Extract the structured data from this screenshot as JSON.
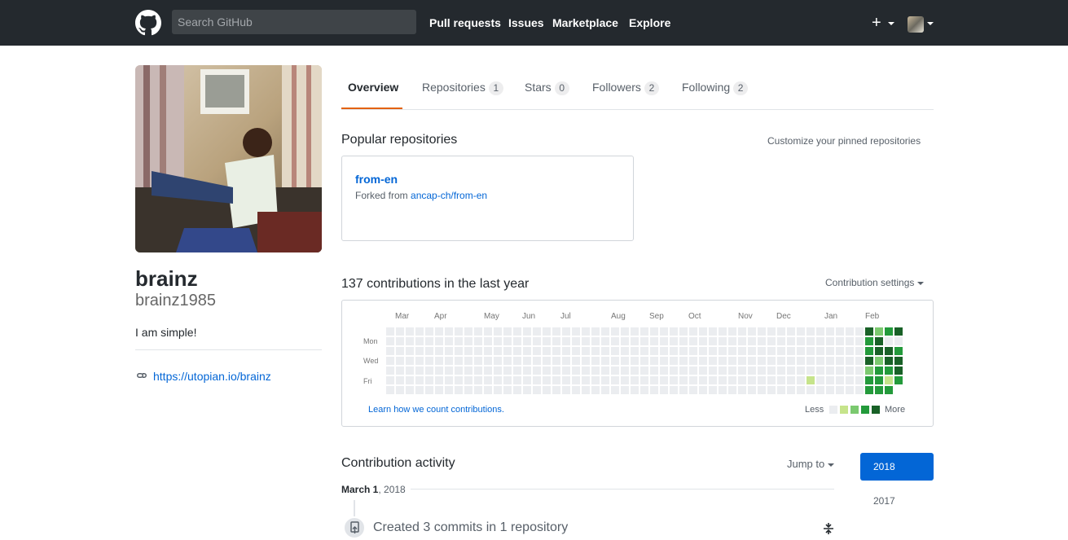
{
  "header": {
    "search_placeholder": "Search GitHub",
    "nav": [
      "Pull requests",
      "Issues",
      "Marketplace",
      "Explore"
    ],
    "plus_label": "+"
  },
  "profile": {
    "name": "brainz",
    "login": "brainz1985",
    "bio": "I am simple!",
    "website": "https://utopian.io/brainz"
  },
  "tabs": [
    {
      "label": "Overview",
      "count": null
    },
    {
      "label": "Repositories",
      "count": "1"
    },
    {
      "label": "Stars",
      "count": "0"
    },
    {
      "label": "Followers",
      "count": "2"
    },
    {
      "label": "Following",
      "count": "2"
    }
  ],
  "popular": {
    "title": "Popular repositories",
    "customize": "Customize your pinned repositories",
    "repo": {
      "name": "from-en",
      "forked_prefix": "Forked from ",
      "forked_source": "ancap-ch/from-en"
    }
  },
  "contributions": {
    "title": "137 contributions in the last year",
    "settings": "Contribution settings",
    "months": [
      "Mar",
      "Apr",
      "May",
      "Jun",
      "Jul",
      "Aug",
      "Sep",
      "Oct",
      "Nov",
      "Dec",
      "Jan",
      "Feb"
    ],
    "days": [
      "Mon",
      "Wed",
      "Fri"
    ],
    "learn": "Learn how we count contributions.",
    "less": "Less",
    "more": "More",
    "colors": [
      "#ebedf0",
      "#c6e48b",
      "#7bc96f",
      "#239a3b",
      "#196127"
    ]
  },
  "activity": {
    "title": "Contribution activity",
    "jump": "Jump to",
    "years": [
      "2018",
      "2017"
    ],
    "date_bold": "March 1",
    "date_rest": ", 2018",
    "summary": "Created 3 commits in 1 repository"
  }
}
